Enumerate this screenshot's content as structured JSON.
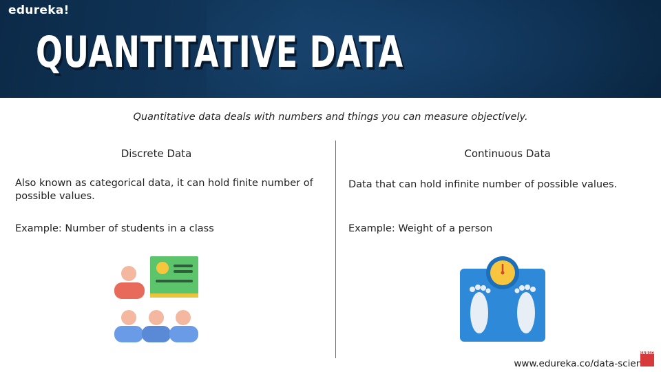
{
  "header": {
    "brand": "edureka!",
    "title": "QUANTITATIVE DATA"
  },
  "subtitle": "Quantitative data deals with numbers and things you can measure objectively.",
  "discrete": {
    "heading": "Discrete Data",
    "description": "Also known as categorical data, it can hold finite number of possible values.",
    "example": "Example: Number of students in a class",
    "icon": "classroom-students-icon"
  },
  "continuous": {
    "heading": "Continuous Data",
    "description": "Data that can hold infinite number of possible values.",
    "example": "Example: Weight of a person",
    "icon": "weighing-scale-icon"
  },
  "footer": {
    "url": "www.edureka.co/data-science",
    "subscribe_badge": "SUBSCRIBE"
  },
  "colors": {
    "header_bg": "#0f345a",
    "title_text": "#ffffff",
    "scale_blue": "#2e8ad8",
    "scale_dial": "#f7c63e",
    "board_green": "#5cc46a",
    "student_red": "#e86a5a",
    "student_blue": "#6a9be6"
  }
}
